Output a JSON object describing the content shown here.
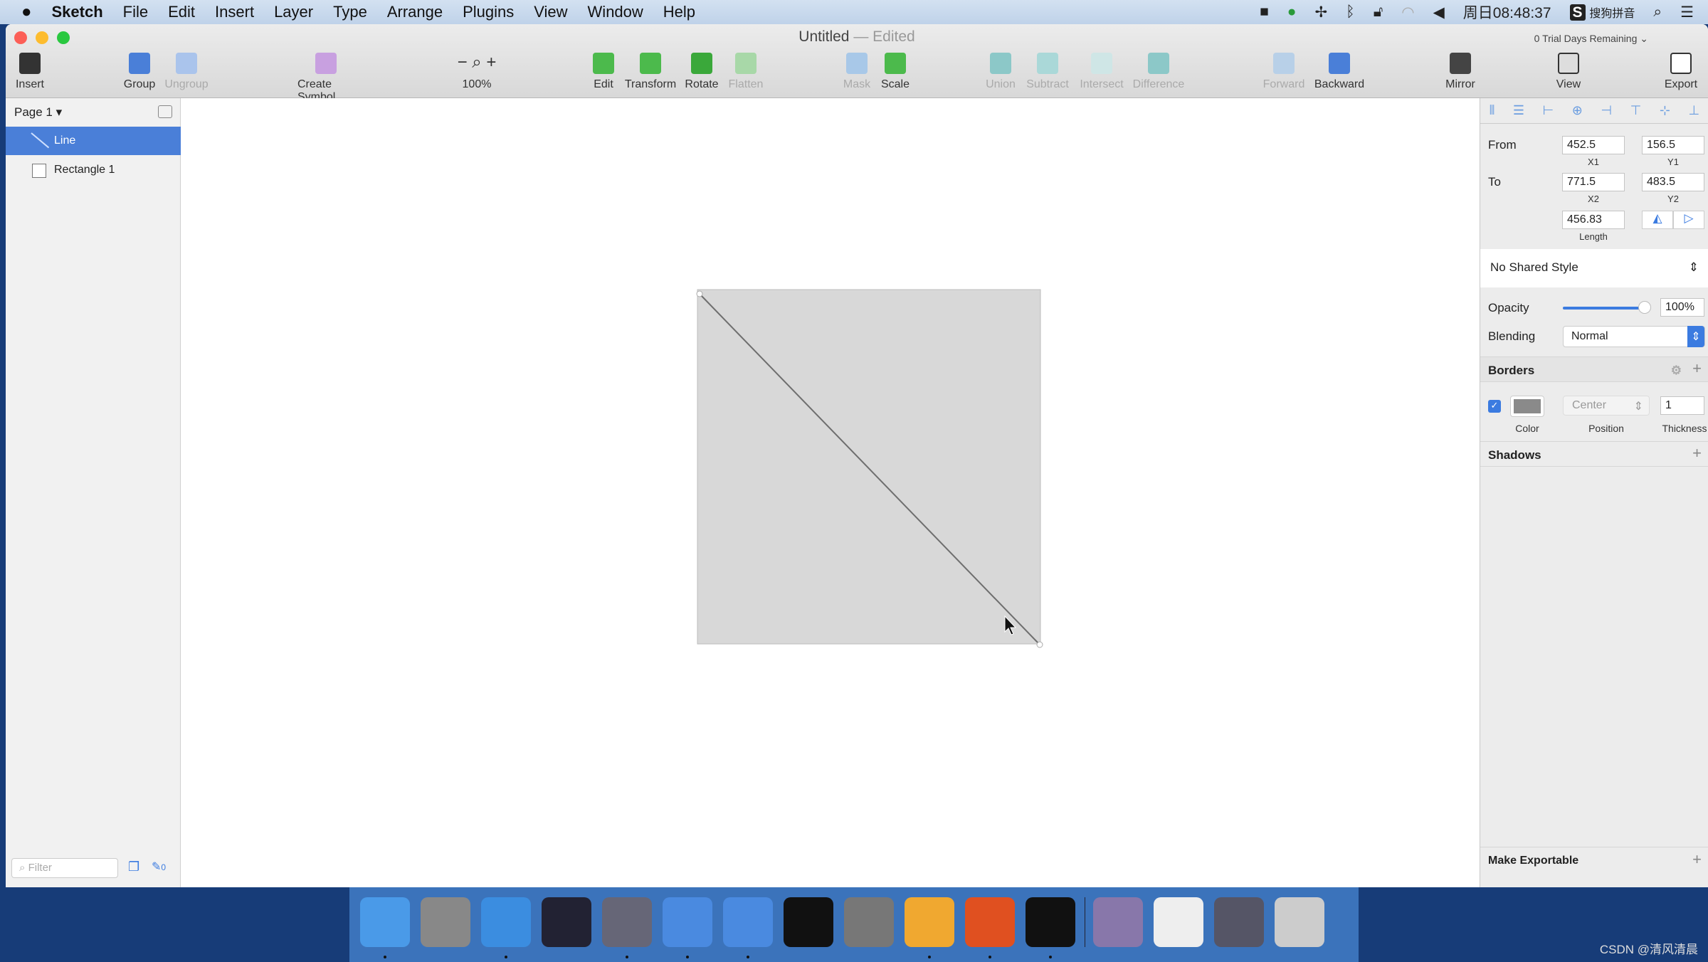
{
  "menubar": {
    "app": "Sketch",
    "items": [
      "File",
      "Edit",
      "Insert",
      "Layer",
      "Type",
      "Arrange",
      "Plugins",
      "View",
      "Window",
      "Help"
    ],
    "clock": "周日08:48:37",
    "ime": "搜狗拼音"
  },
  "window": {
    "title": "Untitled",
    "edited": "— Edited",
    "trial": "0 Trial Days Remaining"
  },
  "toolbar": [
    {
      "label": "Insert",
      "icon": "insert-icon",
      "enabled": true
    },
    {
      "label": "Group",
      "icon": "group-icon",
      "enabled": true
    },
    {
      "label": "Ungroup",
      "icon": "ungroup-icon",
      "enabled": false
    },
    {
      "label": "Create Symbol",
      "icon": "symbol-icon",
      "enabled": true
    },
    {
      "label": "100%",
      "icon": "zoom-icon",
      "enabled": true
    },
    {
      "label": "Edit",
      "icon": "edit-icon",
      "enabled": true
    },
    {
      "label": "Transform",
      "icon": "transform-icon",
      "enabled": true
    },
    {
      "label": "Rotate",
      "icon": "rotate-icon",
      "enabled": true
    },
    {
      "label": "Flatten",
      "icon": "flatten-icon",
      "enabled": false
    },
    {
      "label": "Mask",
      "icon": "mask-icon",
      "enabled": false
    },
    {
      "label": "Scale",
      "icon": "scale-icon",
      "enabled": true
    },
    {
      "label": "Union",
      "icon": "union-icon",
      "enabled": false
    },
    {
      "label": "Subtract",
      "icon": "subtract-icon",
      "enabled": false
    },
    {
      "label": "Intersect",
      "icon": "intersect-icon",
      "enabled": false
    },
    {
      "label": "Difference",
      "icon": "difference-icon",
      "enabled": false
    },
    {
      "label": "Forward",
      "icon": "forward-icon",
      "enabled": false
    },
    {
      "label": "Backward",
      "icon": "backward-icon",
      "enabled": true
    },
    {
      "label": "Mirror",
      "icon": "mirror-icon",
      "enabled": true
    },
    {
      "label": "View",
      "icon": "view-icon",
      "enabled": true
    },
    {
      "label": "Export",
      "icon": "export-icon",
      "enabled": true
    }
  ],
  "sidebar": {
    "page": "Page 1",
    "layers": [
      {
        "name": "Line",
        "selected": true
      },
      {
        "name": "Rectangle 1",
        "selected": false
      }
    ],
    "filter_placeholder": "Filter",
    "edit_count": "0"
  },
  "inspector": {
    "from_label": "From",
    "to_label": "To",
    "x1": "452.5",
    "y1": "156.5",
    "x2": "771.5",
    "y2": "483.5",
    "length": "456.83",
    "x1_label": "X1",
    "y1_label": "Y1",
    "x2_label": "X2",
    "y2_label": "Y2",
    "length_label": "Length",
    "shared_style": "No Shared Style",
    "opacity_label": "Opacity",
    "opacity": "100%",
    "opacity_value": 1.0,
    "blending_label": "Blending",
    "blending": "Normal",
    "borders_label": "Borders",
    "border_enabled": true,
    "border_color": "#8a8a8a",
    "border_position": "Center",
    "border_thickness": "1",
    "color_label": "Color",
    "position_label": "Position",
    "thickness_label": "Thickness",
    "shadows_label": "Shadows",
    "exportable_label": "Make Exportable"
  },
  "colors": {
    "selection": "#4a7fd8",
    "rect_fill": "#d8d8d8",
    "accent": "#3b7be0"
  },
  "watermark": "CSDN @清风清晨"
}
